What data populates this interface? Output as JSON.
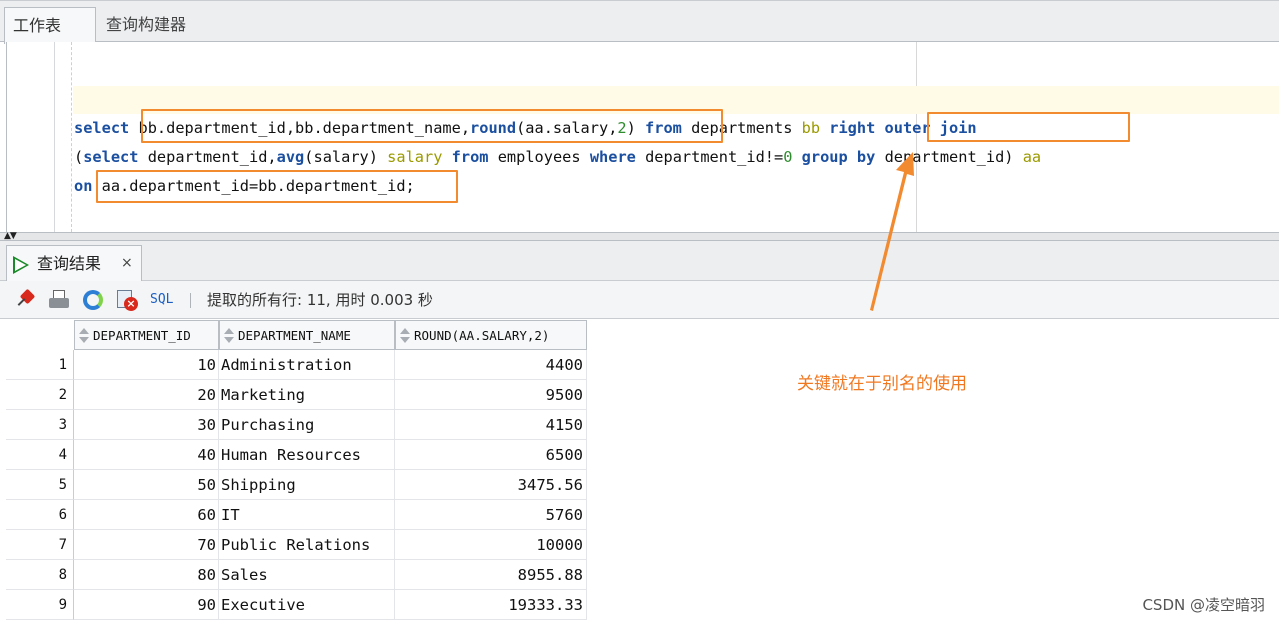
{
  "tabs": {
    "worksheet": "工作表",
    "query_builder": "查询构建器"
  },
  "editor": {
    "line1": {
      "kw_select": "select",
      "part1": "bb.department_id,bb.department_name,",
      "fn_round": "round",
      "part2": "(aa.salary,",
      "num_2": "2",
      "part3": ") ",
      "kw_from": "from",
      "part4": " departments ",
      "alias_bb": "bb",
      "part5": " ",
      "kw_right_outer_join": "right outer join"
    },
    "line2": {
      "part1": "(",
      "kw_select": "select",
      "part2": " department_id,",
      "fn_avg": "avg",
      "part3": "(salary) ",
      "alias_salary": "salary",
      "part4": " ",
      "kw_from": "from",
      "part5": " employees ",
      "kw_where": "where",
      "part6": " department_id!=",
      "num_0": "0",
      "part7": " ",
      "kw_group_by": "group by",
      "part8": " department_id) ",
      "alias_aa": "aa"
    },
    "line3": {
      "kw_on": "on",
      "part1": " aa.department_id=bb.department_id;"
    }
  },
  "results_tab": {
    "label": "查询结果",
    "close": "×"
  },
  "toolbar": {
    "sql_label": "SQL",
    "separator": "|",
    "status": "提取的所有行: 11, 用时 0.003 秒",
    "icons": [
      "pin-icon",
      "print-icon",
      "refresh-icon",
      "delete-icon"
    ]
  },
  "grid": {
    "headers": [
      "DEPARTMENT_ID",
      "DEPARTMENT_NAME",
      "ROUND(AA.SALARY,2)"
    ],
    "rows": [
      {
        "rn": "1",
        "id": "10",
        "name": "Administration",
        "round": "4400"
      },
      {
        "rn": "2",
        "id": "20",
        "name": "Marketing",
        "round": "9500"
      },
      {
        "rn": "3",
        "id": "30",
        "name": "Purchasing",
        "round": "4150"
      },
      {
        "rn": "4",
        "id": "40",
        "name": "Human Resources",
        "round": "6500"
      },
      {
        "rn": "5",
        "id": "50",
        "name": "Shipping",
        "round": "3475.56"
      },
      {
        "rn": "6",
        "id": "60",
        "name": "IT",
        "round": "5760"
      },
      {
        "rn": "7",
        "id": "70",
        "name": "Public Relations",
        "round": "10000"
      },
      {
        "rn": "8",
        "id": "80",
        "name": "Sales",
        "round": "8955.88"
      },
      {
        "rn": "9",
        "id": "90",
        "name": "Executive",
        "round": "19333.33"
      }
    ]
  },
  "annotation": {
    "text": "关键就在于别名的使用",
    "color": "#f07820"
  },
  "watermark": "CSDN @凌空暗羽"
}
